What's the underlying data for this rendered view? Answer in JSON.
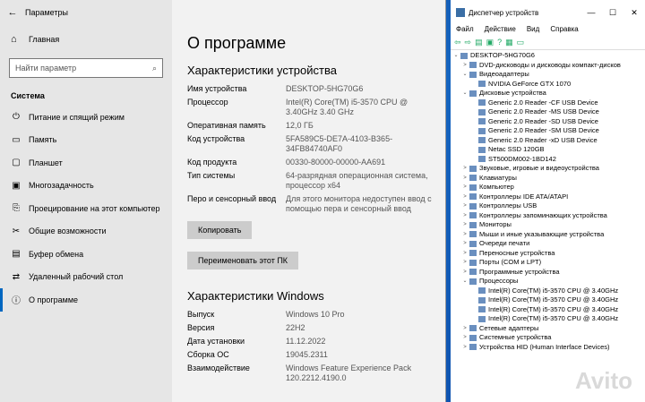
{
  "settings": {
    "title": "Параметры",
    "back": "←",
    "min": "—",
    "max": "☐",
    "close": "✕",
    "home": "Главная",
    "search_placeholder": "Найти параметр",
    "section": "Система",
    "nav": [
      "Питание и спящий режим",
      "Память",
      "Планшет",
      "Многозадачность",
      "Проецирование на этот компьютер",
      "Общие возможности",
      "Буфер обмена",
      "Удаленный рабочий стол",
      "О программе"
    ]
  },
  "about": {
    "title": "О программе",
    "device_heading": "Характеристики устройства",
    "device": [
      {
        "k": "Имя устройства",
        "v": "DESKTOP-5HG70G6"
      },
      {
        "k": "Процессор",
        "v": "Intel(R) Core(TM) i5-3570 CPU @ 3.40GHz   3.40 GHz"
      },
      {
        "k": "Оперативная память",
        "v": "12,0 ГБ"
      },
      {
        "k": "Код устройства",
        "v": "5FA589C5-DE7A-4103-B365-34FB84740AF0"
      },
      {
        "k": "Код продукта",
        "v": "00330-80000-00000-AA691"
      },
      {
        "k": "Тип системы",
        "v": "64-разрядная операционная система, процессор x64"
      },
      {
        "k": "Перо и сенсорный ввод",
        "v": "Для этого монитора недоступен ввод с помощью пера и сенсорный ввод"
      }
    ],
    "copy_btn": "Копировать",
    "rename_btn": "Переименовать этот ПК",
    "win_heading": "Характеристики Windows",
    "windows": [
      {
        "k": "Выпуск",
        "v": "Windows 10 Pro"
      },
      {
        "k": "Версия",
        "v": "22H2"
      },
      {
        "k": "Дата установки",
        "v": "11.12.2022"
      },
      {
        "k": "Сборка ОС",
        "v": "19045.2311"
      },
      {
        "k": "Взаимодействие",
        "v": "Windows Feature Experience Pack 120.2212.4190.0"
      }
    ]
  },
  "dm": {
    "title": "Диспетчер устройств",
    "menu": [
      "Файл",
      "Действие",
      "Вид",
      "Справка"
    ],
    "min": "—",
    "max": "☐",
    "close": "✕",
    "tree": [
      {
        "t": "DESKTOP-5HG70G6",
        "l": 0,
        "a": "⌄"
      },
      {
        "t": "DVD-дисководы и дисководы компакт-дисков",
        "l": 1,
        "a": ">"
      },
      {
        "t": "Видеоадаптеры",
        "l": 1,
        "a": "⌄"
      },
      {
        "t": "NVIDIA GeForce GTX 1070",
        "l": 2,
        "a": ""
      },
      {
        "t": "Дисковые устройства",
        "l": 1,
        "a": "⌄"
      },
      {
        "t": "Generic 2.0 Reader  -CF USB Device",
        "l": 2,
        "a": ""
      },
      {
        "t": "Generic 2.0 Reader  -MS USB Device",
        "l": 2,
        "a": ""
      },
      {
        "t": "Generic 2.0 Reader  -SD USB Device",
        "l": 2,
        "a": ""
      },
      {
        "t": "Generic 2.0 Reader  -SM USB Device",
        "l": 2,
        "a": ""
      },
      {
        "t": "Generic 2.0 Reader  -xD USB Device",
        "l": 2,
        "a": ""
      },
      {
        "t": "Netac SSD 120GB",
        "l": 2,
        "a": ""
      },
      {
        "t": "ST500DM002-1BD142",
        "l": 2,
        "a": ""
      },
      {
        "t": "Звуковые, игровые и видеоустройства",
        "l": 1,
        "a": ">"
      },
      {
        "t": "Клавиатуры",
        "l": 1,
        "a": ">"
      },
      {
        "t": "Компьютер",
        "l": 1,
        "a": ">"
      },
      {
        "t": "Контроллеры IDE ATA/ATAPI",
        "l": 1,
        "a": ">"
      },
      {
        "t": "Контроллеры USB",
        "l": 1,
        "a": ">"
      },
      {
        "t": "Контроллеры запоминающих устройства",
        "l": 1,
        "a": ">"
      },
      {
        "t": "Мониторы",
        "l": 1,
        "a": ">"
      },
      {
        "t": "Мыши и иные указывающие устройства",
        "l": 1,
        "a": ">"
      },
      {
        "t": "Очереди печати",
        "l": 1,
        "a": ">"
      },
      {
        "t": "Переносные устройства",
        "l": 1,
        "a": ">"
      },
      {
        "t": "Порты (COM и LPT)",
        "l": 1,
        "a": ">"
      },
      {
        "t": "Программные устройства",
        "l": 1,
        "a": ">"
      },
      {
        "t": "Процессоры",
        "l": 1,
        "a": "⌄"
      },
      {
        "t": "Intel(R) Core(TM) i5-3570 CPU @ 3.40GHz",
        "l": 2,
        "a": ""
      },
      {
        "t": "Intel(R) Core(TM) i5-3570 CPU @ 3.40GHz",
        "l": 2,
        "a": ""
      },
      {
        "t": "Intel(R) Core(TM) i5-3570 CPU @ 3.40GHz",
        "l": 2,
        "a": ""
      },
      {
        "t": "Intel(R) Core(TM) i5-3570 CPU @ 3.40GHz",
        "l": 2,
        "a": ""
      },
      {
        "t": "Сетевые адаптеры",
        "l": 1,
        "a": ">"
      },
      {
        "t": "Системные устройства",
        "l": 1,
        "a": ">"
      },
      {
        "t": "Устройства HID (Human Interface Devices)",
        "l": 1,
        "a": ">"
      }
    ]
  },
  "watermark": "Avito"
}
